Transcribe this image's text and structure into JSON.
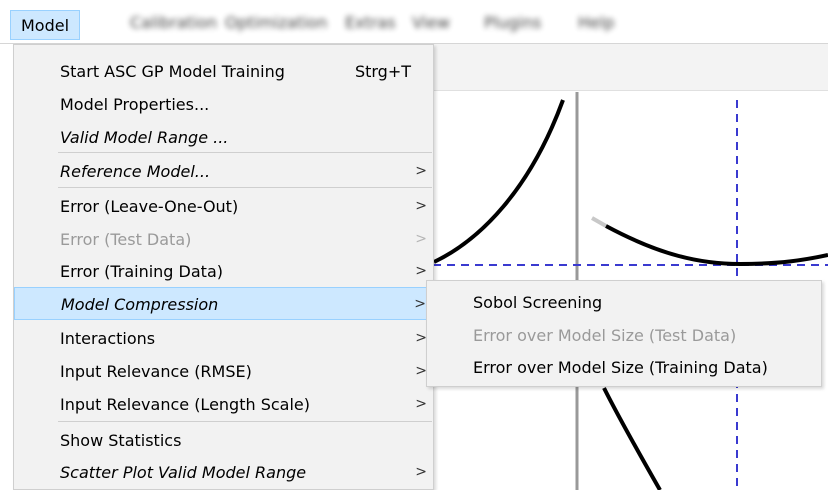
{
  "menubar": {
    "active": "Model",
    "blurred_items": [
      "Calibration",
      "Optimization",
      "Extras",
      "View",
      "Plugins",
      "Help"
    ]
  },
  "menu": {
    "groups": [
      [
        {
          "label": "Start ASC GP Model Training",
          "shortcut": "Strg+T",
          "italic": false,
          "disabled": false,
          "submenu": false
        },
        {
          "label": "Model Properties...",
          "italic": false,
          "disabled": false,
          "submenu": false
        },
        {
          "label": "Valid Model Range ...",
          "italic": true,
          "disabled": false,
          "submenu": false
        }
      ],
      [
        {
          "label": "Reference Model...",
          "italic": true,
          "disabled": false,
          "submenu": true
        }
      ],
      [
        {
          "label": "Error (Leave-One-Out)",
          "italic": false,
          "disabled": false,
          "submenu": true
        },
        {
          "label": "Error (Test Data)",
          "italic": false,
          "disabled": true,
          "submenu": true
        },
        {
          "label": "Error (Training Data)",
          "italic": false,
          "disabled": false,
          "submenu": true
        },
        {
          "label": "Model Compression",
          "italic": true,
          "disabled": false,
          "submenu": true,
          "highlighted": true
        },
        {
          "label": "Interactions",
          "italic": false,
          "disabled": false,
          "submenu": true
        },
        {
          "label": "Input Relevance (RMSE)",
          "italic": false,
          "disabled": false,
          "submenu": true
        },
        {
          "label": "Input Relevance (Length Scale)",
          "italic": false,
          "disabled": false,
          "submenu": true
        }
      ],
      [
        {
          "label": "Show Statistics",
          "italic": false,
          "disabled": false,
          "submenu": false
        },
        {
          "label": "Scatter Plot Valid Model Range",
          "italic": true,
          "disabled": false,
          "submenu": true
        }
      ]
    ]
  },
  "submenu": {
    "items": [
      {
        "label": "Sobol Screening",
        "disabled": false
      },
      {
        "label": "Error over Model Size (Test Data)",
        "disabled": true
      },
      {
        "label": "Error over Model Size (Training Data)",
        "disabled": false
      }
    ]
  },
  "icons": {
    "submenu_arrow": "chevron-right-icon"
  },
  "colors": {
    "highlight": "#cde8ff",
    "highlight_border": "#99d1ff",
    "plot_dash": "#3a3ad0"
  }
}
